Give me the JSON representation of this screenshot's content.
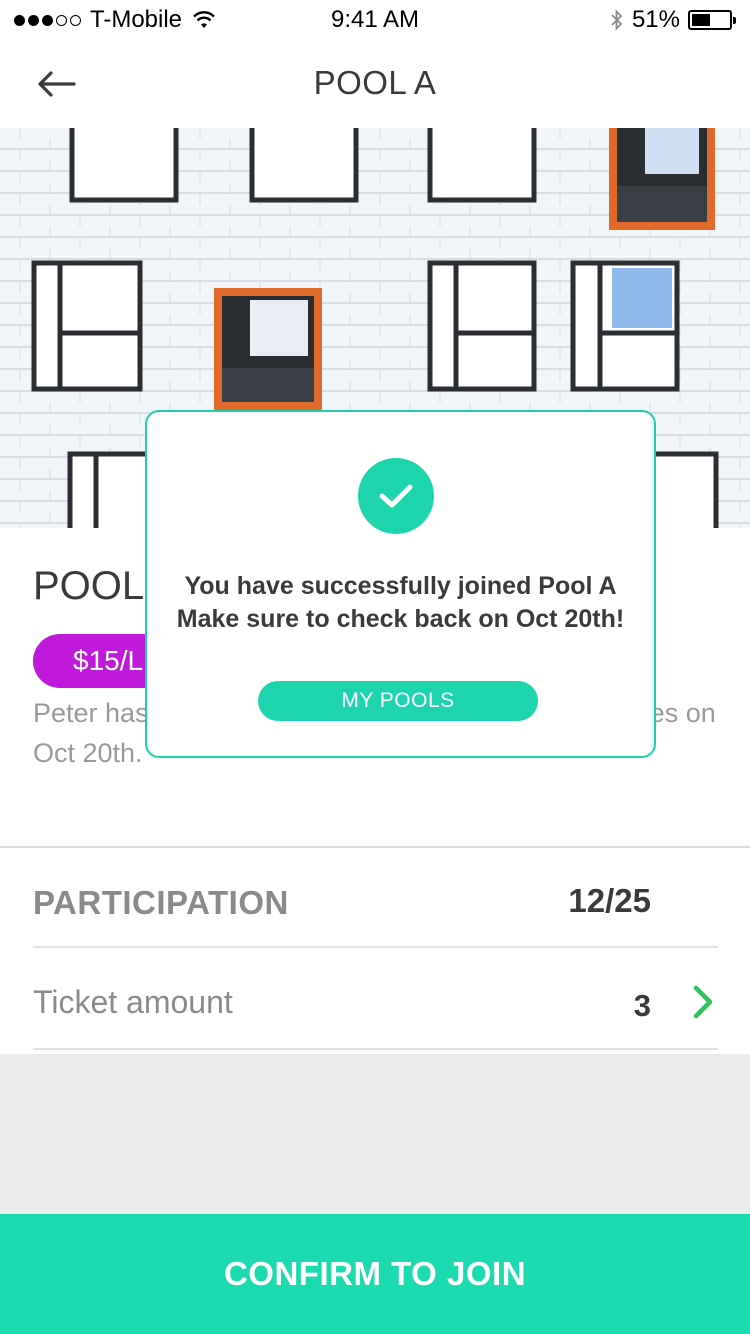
{
  "status_bar": {
    "carrier": "T-Mobile",
    "time": "9:41 AM",
    "battery": "51%",
    "battery_level": 0.51,
    "signal_bars_filled": 3,
    "signal_bars_total": 5
  },
  "nav": {
    "title": "POOL A",
    "back_icon": "arrow-left-icon"
  },
  "pool": {
    "name": "POOL",
    "price_label": "$15/L",
    "description": "Peter has                                                               oses on Oct 20th."
  },
  "info": {
    "participation_label": "PARTICIPATION",
    "participation_value": "12/25",
    "ticket_label": "Ticket amount",
    "ticket_value": "3"
  },
  "cta": {
    "label": "CONFIRM TO JOIN"
  },
  "modal": {
    "line1": "You have successfully joined Pool A",
    "line2": "Make sure to check back on Oct 20th!",
    "button_label": "MY POOLS",
    "icon": "check-icon"
  },
  "colors": {
    "accent": "#1bdab0",
    "price_pill": "#bf1ad9",
    "chevron": "#2fc25a"
  }
}
